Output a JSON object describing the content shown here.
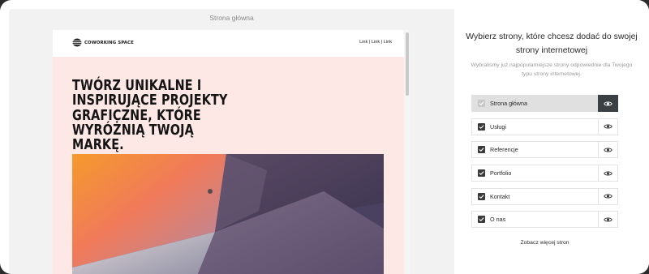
{
  "preview": {
    "title": "Strona główna",
    "site": {
      "logo_text": "COWORKING SPACE",
      "nav_links": "Link | Link | Link",
      "hero_title": "TWÓRZ UNIKALNE I INSPIRUJĄCE PROJEKTY GRAFICZNE, KTÓRE WYRÓŻNIĄ TWOJĄ MARKĘ."
    }
  },
  "panel": {
    "title": "Wybierz strony, które chcesz dodać do swojej strony internetowej",
    "subtitle": "Wybraliśmy już najpopularniejsze strony odpowiednie dla Twojego typu strony internetowej.",
    "pages": [
      {
        "label": "Strona główna",
        "checked": true,
        "active": true
      },
      {
        "label": "Usługi",
        "checked": true,
        "active": false
      },
      {
        "label": "Referencje",
        "checked": true,
        "active": false
      },
      {
        "label": "Portfolio",
        "checked": true,
        "active": false
      },
      {
        "label": "Kontakt",
        "checked": true,
        "active": false
      },
      {
        "label": "O nas",
        "checked": true,
        "active": false
      }
    ],
    "more_link": "Zobacz więcej stron"
  }
}
